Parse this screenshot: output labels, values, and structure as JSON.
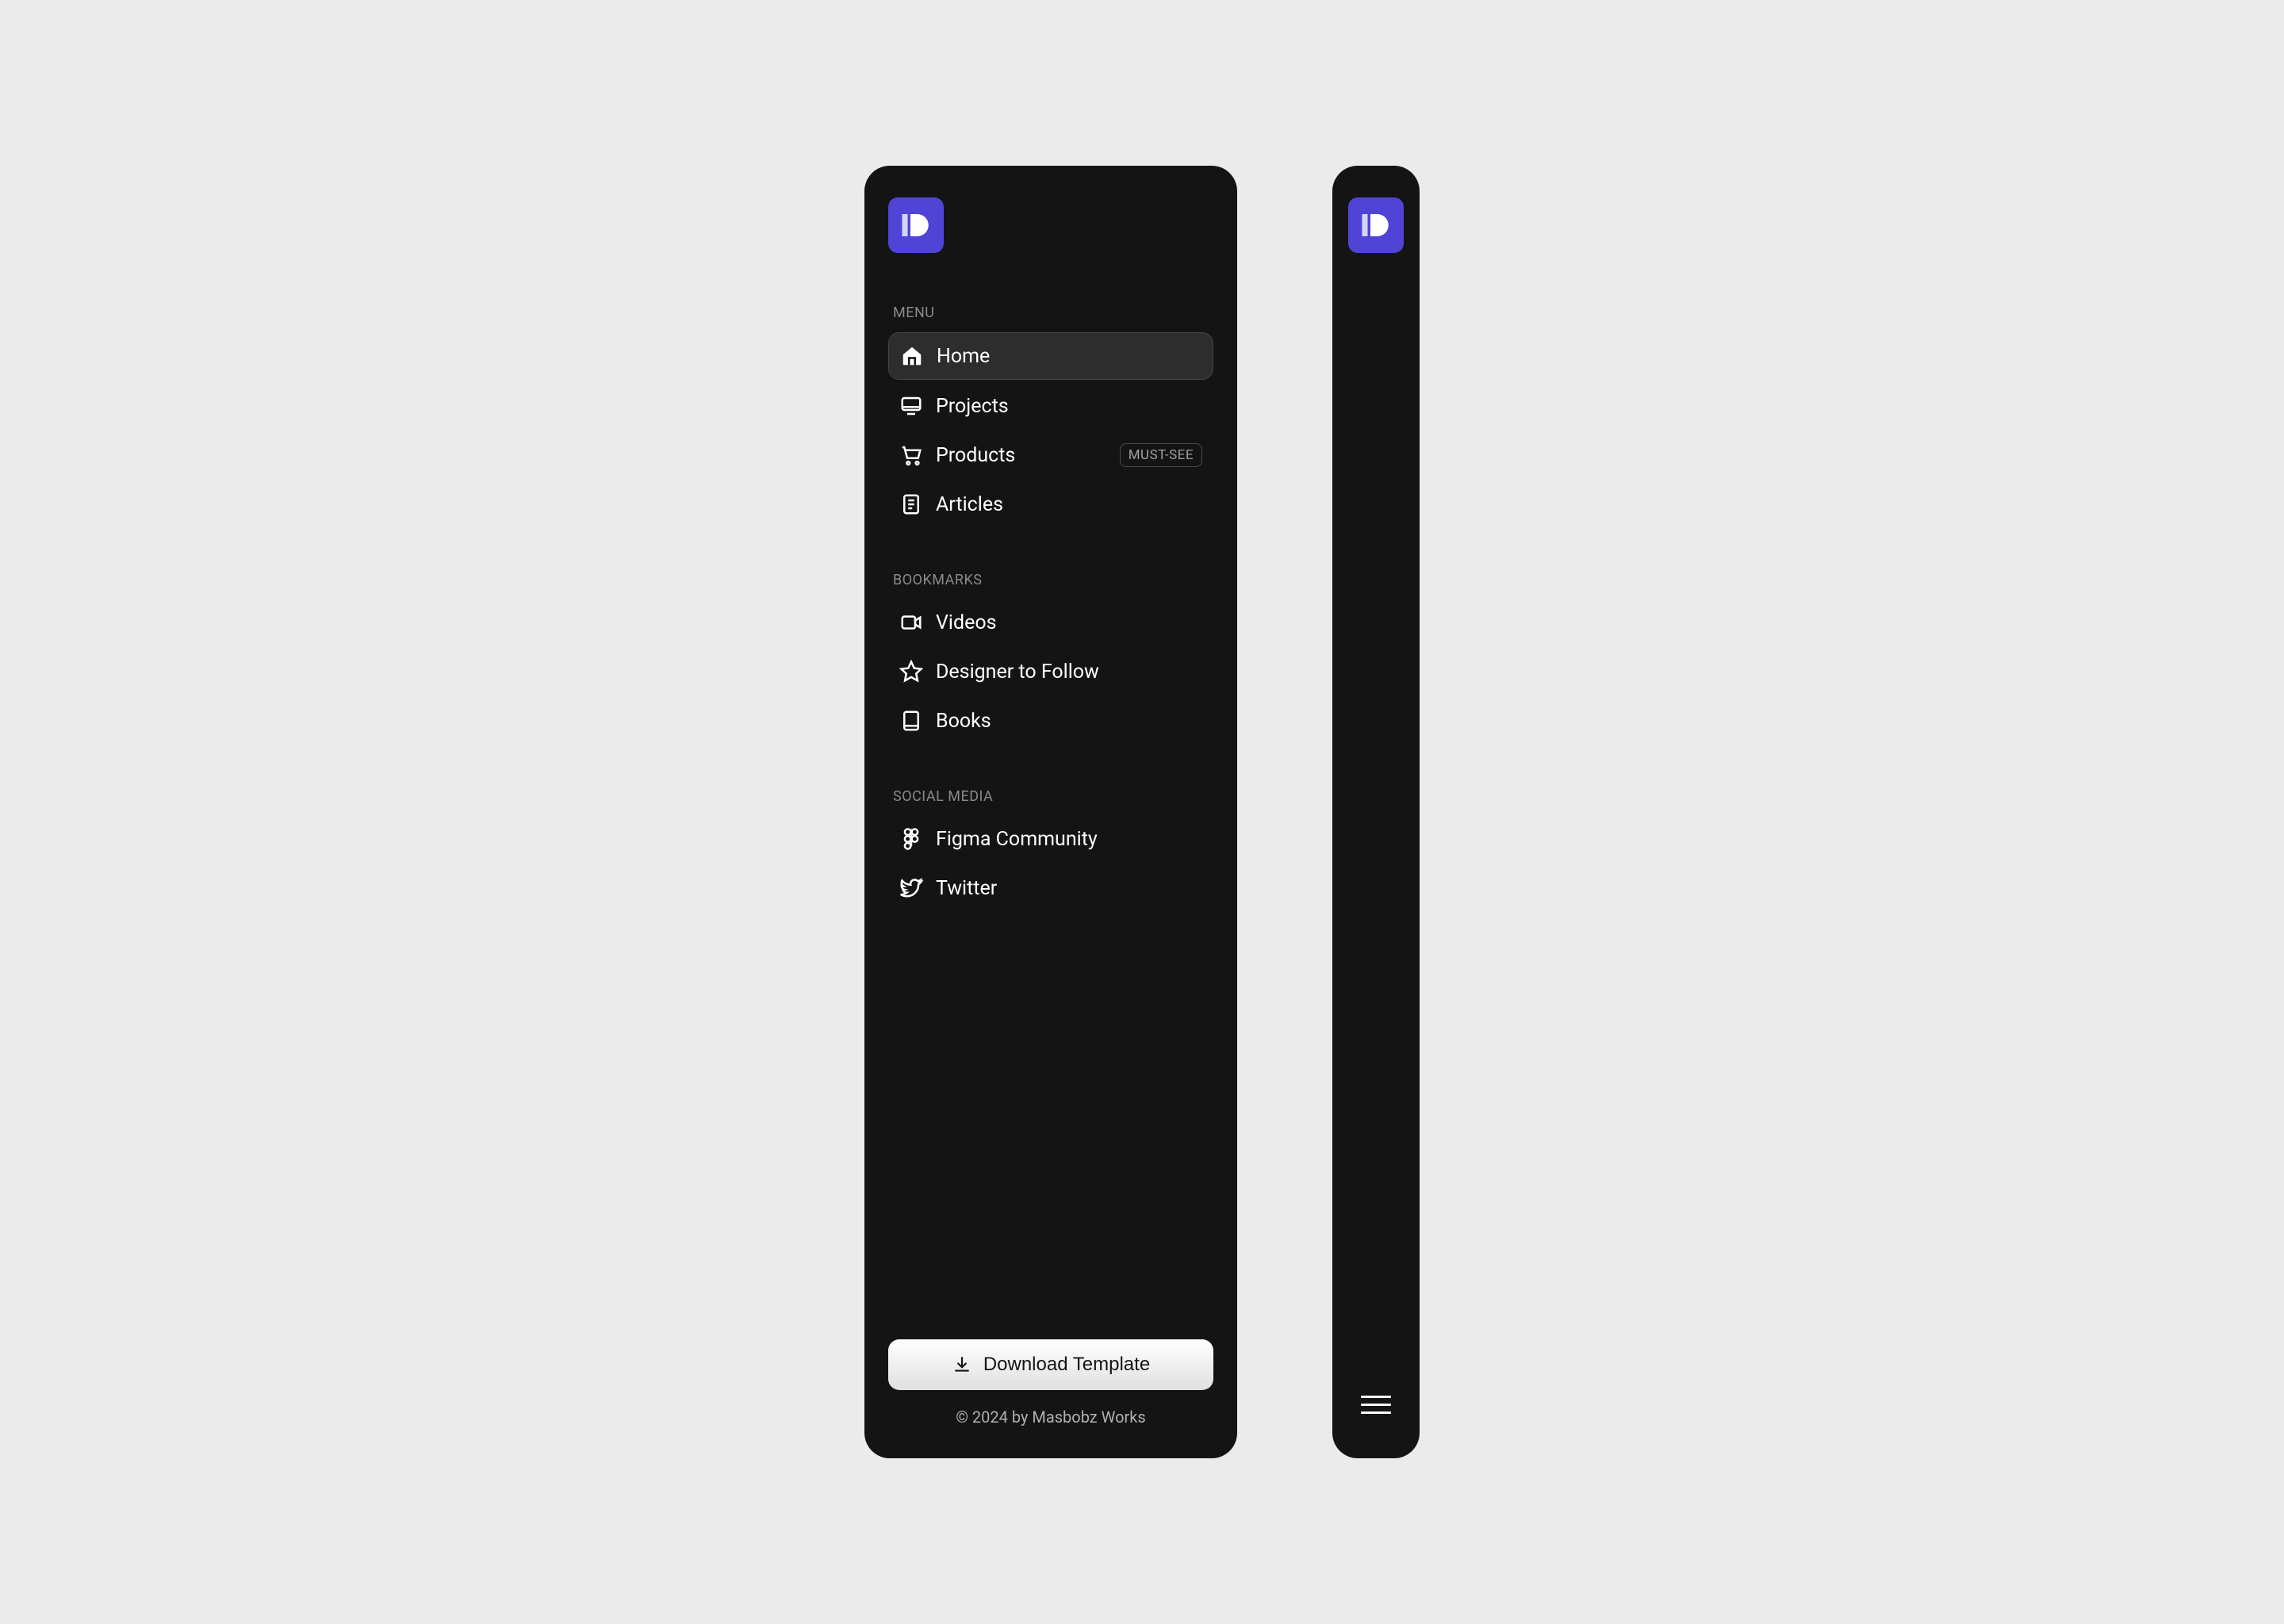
{
  "sections": {
    "menu": {
      "title": "MENU",
      "items": [
        {
          "label": "Home",
          "icon": "home-icon",
          "active": true
        },
        {
          "label": "Projects",
          "icon": "monitor-icon"
        },
        {
          "label": "Products",
          "icon": "cart-icon",
          "badge": "MUST-SEE"
        },
        {
          "label": "Articles",
          "icon": "document-icon"
        }
      ]
    },
    "bookmarks": {
      "title": "BOOKMARKS",
      "items": [
        {
          "label": "Videos",
          "icon": "video-icon"
        },
        {
          "label": "Designer to Follow",
          "icon": "star-icon"
        },
        {
          "label": "Books",
          "icon": "book-icon"
        }
      ]
    },
    "social": {
      "title": "SOCIAL MEDIA",
      "items": [
        {
          "label": "Figma Community",
          "icon": "figma-icon"
        },
        {
          "label": "Twitter",
          "icon": "twitter-icon"
        }
      ]
    }
  },
  "download_button": "Download Template",
  "copyright": "© 2024 by Masbobz Works"
}
